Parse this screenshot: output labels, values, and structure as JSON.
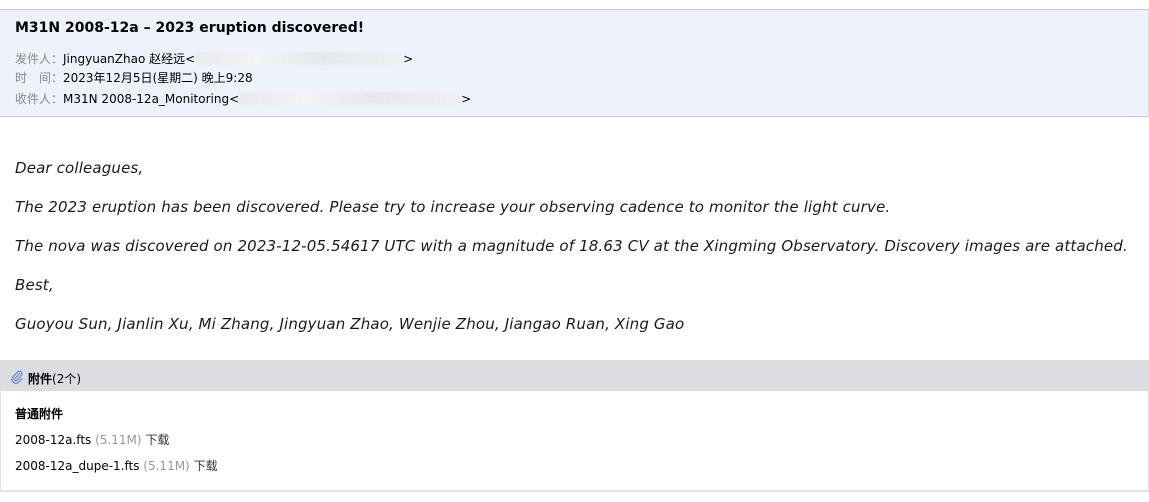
{
  "email": {
    "subject": "M31N 2008-12a – 2023 eruption discovered!",
    "from_label": "发件人：",
    "from_value": "JingyuanZhao 赵经远<",
    "from_suffix": ">",
    "time_label": "时　间：",
    "time_value": "2023年12月5日(星期二) 晚上9:28",
    "to_label": "收件人：",
    "to_value": "M31N 2008-12a_Monitoring<",
    "to_suffix": ">"
  },
  "body": {
    "greeting": "Dear colleagues,",
    "para1": "The 2023 eruption has been discovered. Please try to increase your observing cadence to monitor the light curve.",
    "para2": "The nova was discovered on 2023-12-05.54617 UTC with a magnitude of 18.63 CV at the Xingming Observatory. Discovery images are attached.",
    "closing": "Best,",
    "signature": "Guoyou Sun, Jianlin Xu, Mi Zhang, Jingyuan Zhao, Wenjie Zhou, Jiangao Ruan, Xing Gao"
  },
  "attachments": {
    "title": "附件",
    "count": "(2个)",
    "section": "普通附件",
    "files": [
      {
        "name": "2008-12a.fts",
        "size": "(5.11M)",
        "download": "下载"
      },
      {
        "name": "2008-12a_dupe-1.fts",
        "size": "(5.11M)",
        "download": "下载"
      }
    ]
  },
  "icons": {
    "attachment": "paperclip-icon"
  },
  "colors": {
    "header_bg": "#eef3fb",
    "attachment_bar_bg": "#dcdde2",
    "muted": "#888888"
  }
}
